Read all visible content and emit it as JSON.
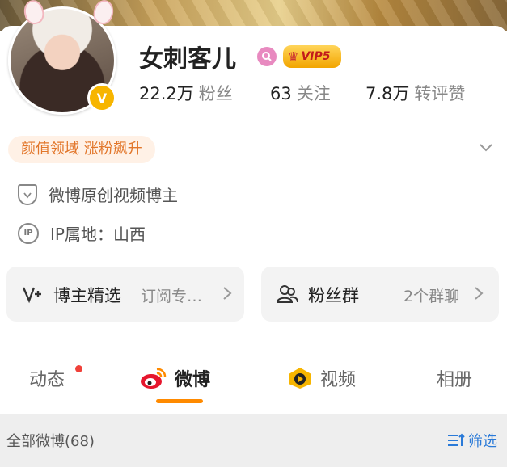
{
  "profile": {
    "name": "女刺客儿",
    "vip_label": "VIP5",
    "stats": [
      {
        "value": "22.2万",
        "label": "粉丝"
      },
      {
        "value": "63",
        "label": "关注"
      },
      {
        "value": "7.8万",
        "label": "转评赞"
      }
    ]
  },
  "tag_pill": "颜值领域 涨粉飙升",
  "info": {
    "certification": "微博原创视频博主",
    "ip_location": "IP属地：山西"
  },
  "entries": {
    "featured": {
      "title": "博主精选",
      "subtitle": "订阅专…"
    },
    "fan_group": {
      "title": "粉丝群",
      "subtitle": "2个群聊"
    }
  },
  "tabs": [
    {
      "label": "动态"
    },
    {
      "label": "微博"
    },
    {
      "label": "视频"
    },
    {
      "label": "相册"
    }
  ],
  "filter": {
    "label": "全部微博(68)",
    "button": "筛选"
  },
  "colors": {
    "accent_orange": "#ff8a00",
    "tag_text": "#e2762a",
    "tag_bg": "#fff1e6",
    "link_blue": "#2a7ad8",
    "notification_red": "#f0413a",
    "vip_gold": "#f2a500"
  }
}
